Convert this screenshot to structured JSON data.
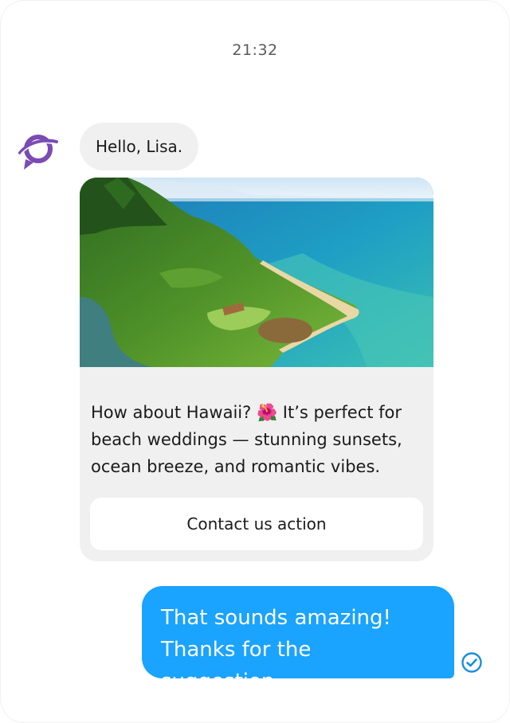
{
  "conversation": {
    "timestamp": "21:32",
    "messages": [
      {
        "from": "bot",
        "text": "Hello, Lisa."
      },
      {
        "from": "bot",
        "type": "rich_card",
        "image_alt": "Aerial view of a green Hawaiian coastline with turquoise ocean",
        "text": "How about Hawaii? 🌺 It’s perfect for beach weddings — stunning sunsets, ocean breeze, and romantic vibes.",
        "action_label": "Contact us action"
      },
      {
        "from": "user",
        "text": "That sounds amazing! Thanks for the suggestion.",
        "status": "read"
      }
    ]
  },
  "icons": {
    "bot_avatar": "brand-chat-logo-icon",
    "read_receipt": "check-circle-icon"
  },
  "colors": {
    "brand_purple": "#7b4bb3",
    "user_bubble": "#1aa3ff",
    "bot_bubble": "#f0f0f0"
  }
}
